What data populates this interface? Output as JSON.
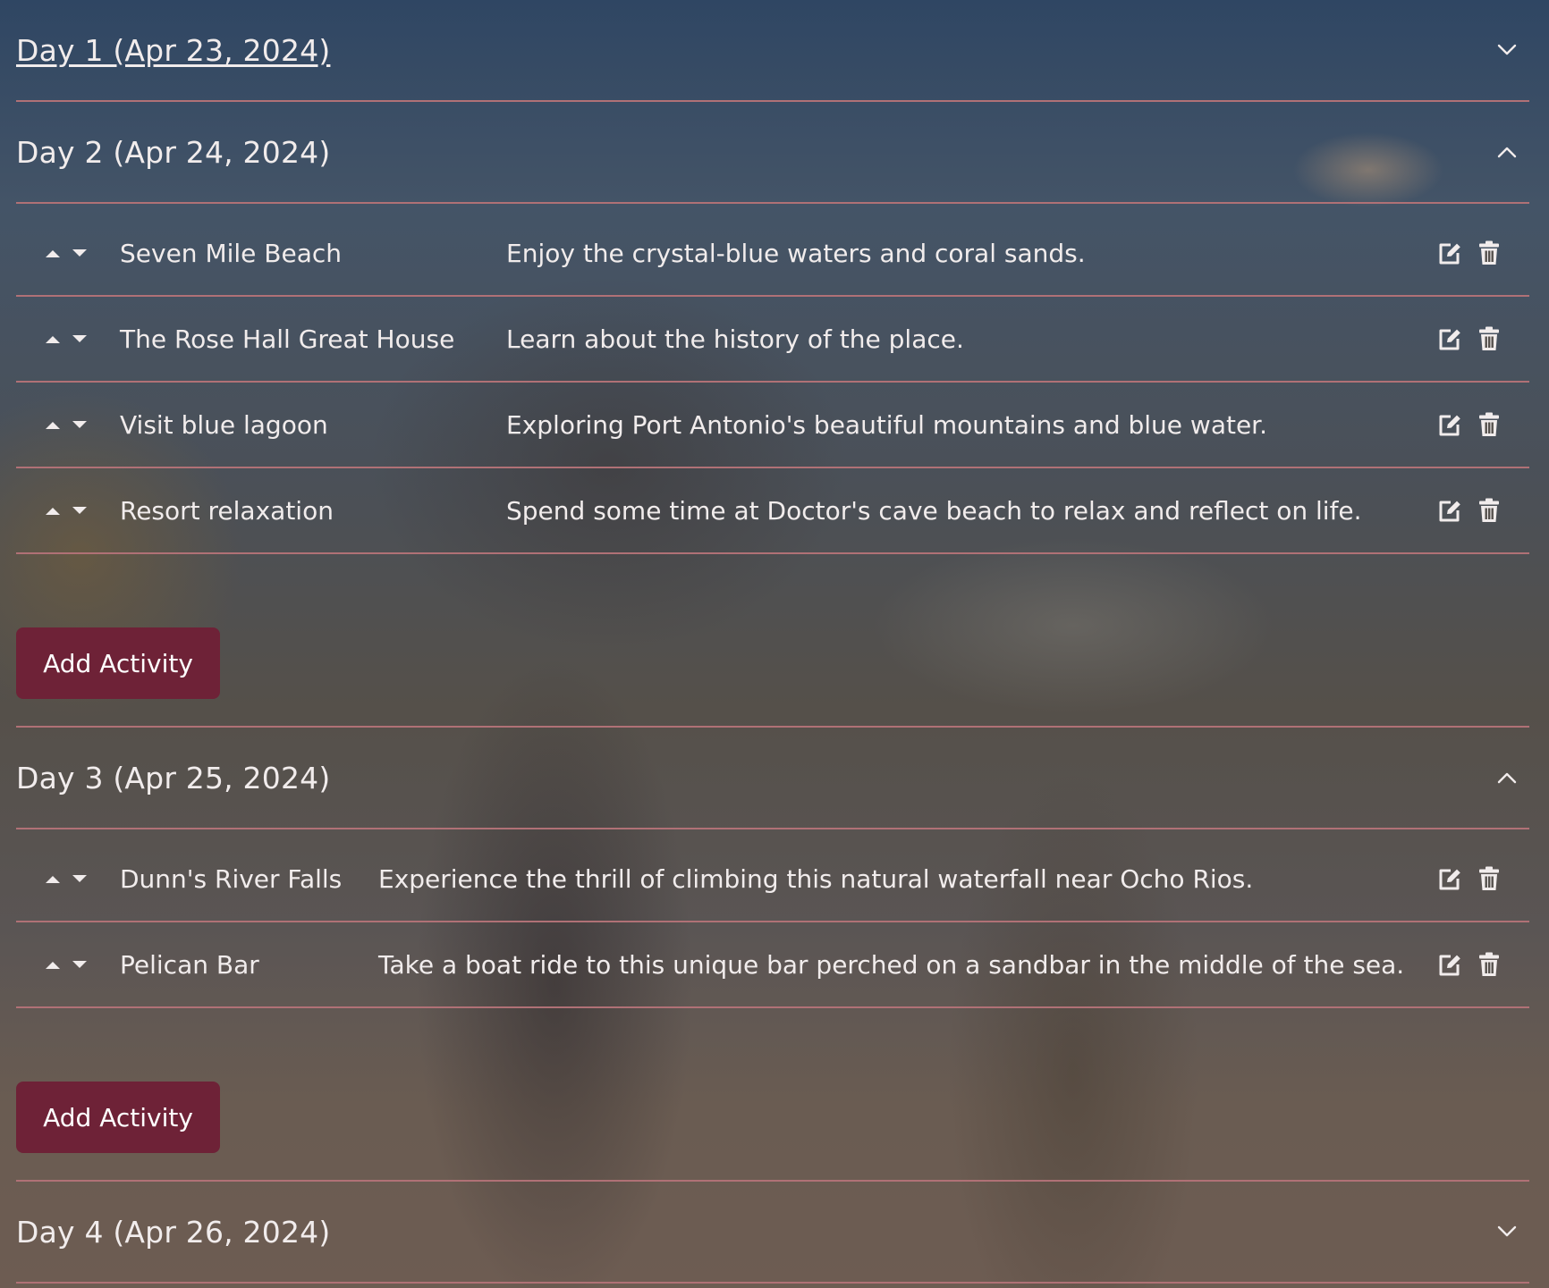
{
  "days": [
    {
      "title": "Day 1 (Apr 23, 2024)",
      "state": "collapsed"
    },
    {
      "title": "Day 2 (Apr 24, 2024)",
      "state": "expanded",
      "activities": [
        {
          "name": "Seven Mile Beach",
          "description": "Enjoy the crystal-blue waters and coral sands."
        },
        {
          "name": "The Rose Hall Great House",
          "description": "Learn about the history of the place."
        },
        {
          "name": "Visit blue lagoon",
          "description": "Exploring Port Antonio's beautiful mountains and blue water."
        },
        {
          "name": "Resort relaxation",
          "description": "Spend some time at Doctor's cave beach to relax and reflect on life."
        }
      ],
      "add_label": "Add Activity"
    },
    {
      "title": "Day 3 (Apr 25, 2024)",
      "state": "expanded",
      "activities": [
        {
          "name": "Dunn's River Falls",
          "description": "Experience the thrill of climbing this natural waterfall near Ocho Rios."
        },
        {
          "name": "Pelican Bar",
          "description": "Take a boat ride to this unique bar perched on a sandbar in the middle of the sea."
        }
      ],
      "add_label": "Add Activity"
    },
    {
      "title": "Day 4 (Apr 26, 2024)",
      "state": "collapsed"
    }
  ],
  "icons": {
    "expand": "chevron-down-icon",
    "collapse": "chevron-up-icon",
    "move_up": "caret-up-icon",
    "move_down": "caret-down-icon",
    "edit": "edit-icon",
    "delete": "trash-icon"
  },
  "colors": {
    "accent": "#6e2237",
    "divider": "#b07176",
    "text": "#f1ecec"
  }
}
